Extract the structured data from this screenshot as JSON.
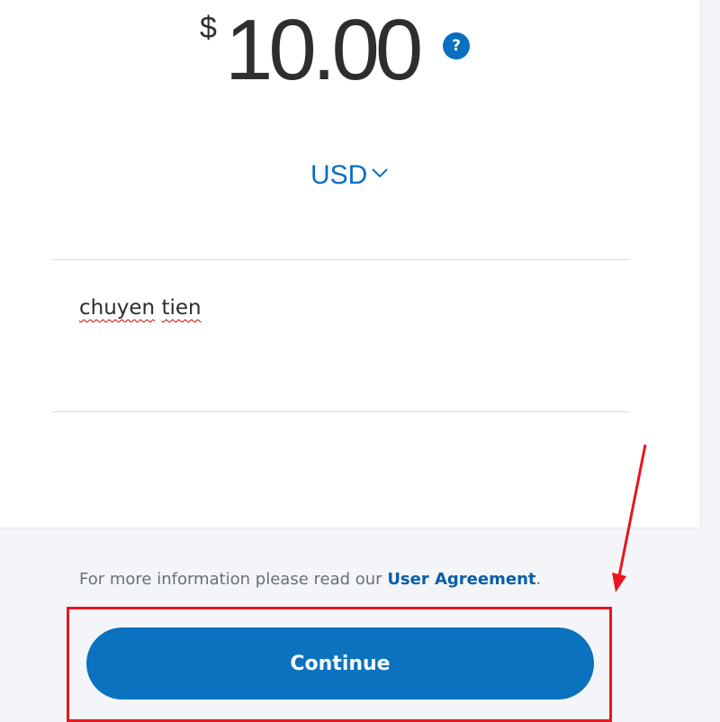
{
  "payment": {
    "currency_symbol": "$",
    "amount": "10.00",
    "help_glyph": "?",
    "currency_code": "USD",
    "note": [
      "chuyen",
      "tien"
    ]
  },
  "footer": {
    "agreement_prefix": "For more information please read our ",
    "agreement_link": "User Agreement",
    "agreement_suffix": "."
  },
  "actions": {
    "continue_label": "Continue"
  },
  "icons": {
    "help": "question-circle-icon",
    "currency_dropdown": "chevron-down-icon"
  },
  "colors": {
    "brand_blue": "#0a72bf",
    "link_blue": "#0a5ea8",
    "annotation_red": "#e8151f",
    "page_background": "#f4f5f8"
  }
}
